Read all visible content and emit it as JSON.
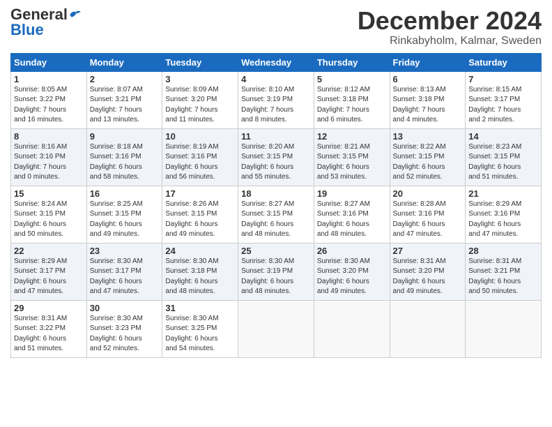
{
  "logo": {
    "general": "General",
    "blue": "Blue"
  },
  "title": "December 2024",
  "location": "Rinkabyholm, Kalmar, Sweden",
  "days_header": [
    "Sunday",
    "Monday",
    "Tuesday",
    "Wednesday",
    "Thursday",
    "Friday",
    "Saturday"
  ],
  "weeks": [
    [
      {
        "day": "1",
        "info": "Sunrise: 8:05 AM\nSunset: 3:22 PM\nDaylight: 7 hours\nand 16 minutes."
      },
      {
        "day": "2",
        "info": "Sunrise: 8:07 AM\nSunset: 3:21 PM\nDaylight: 7 hours\nand 13 minutes."
      },
      {
        "day": "3",
        "info": "Sunrise: 8:09 AM\nSunset: 3:20 PM\nDaylight: 7 hours\nand 11 minutes."
      },
      {
        "day": "4",
        "info": "Sunrise: 8:10 AM\nSunset: 3:19 PM\nDaylight: 7 hours\nand 8 minutes."
      },
      {
        "day": "5",
        "info": "Sunrise: 8:12 AM\nSunset: 3:18 PM\nDaylight: 7 hours\nand 6 minutes."
      },
      {
        "day": "6",
        "info": "Sunrise: 8:13 AM\nSunset: 3:18 PM\nDaylight: 7 hours\nand 4 minutes."
      },
      {
        "day": "7",
        "info": "Sunrise: 8:15 AM\nSunset: 3:17 PM\nDaylight: 7 hours\nand 2 minutes."
      }
    ],
    [
      {
        "day": "8",
        "info": "Sunrise: 8:16 AM\nSunset: 3:16 PM\nDaylight: 7 hours\nand 0 minutes."
      },
      {
        "day": "9",
        "info": "Sunrise: 8:18 AM\nSunset: 3:16 PM\nDaylight: 6 hours\nand 58 minutes."
      },
      {
        "day": "10",
        "info": "Sunrise: 8:19 AM\nSunset: 3:16 PM\nDaylight: 6 hours\nand 56 minutes."
      },
      {
        "day": "11",
        "info": "Sunrise: 8:20 AM\nSunset: 3:15 PM\nDaylight: 6 hours\nand 55 minutes."
      },
      {
        "day": "12",
        "info": "Sunrise: 8:21 AM\nSunset: 3:15 PM\nDaylight: 6 hours\nand 53 minutes."
      },
      {
        "day": "13",
        "info": "Sunrise: 8:22 AM\nSunset: 3:15 PM\nDaylight: 6 hours\nand 52 minutes."
      },
      {
        "day": "14",
        "info": "Sunrise: 8:23 AM\nSunset: 3:15 PM\nDaylight: 6 hours\nand 51 minutes."
      }
    ],
    [
      {
        "day": "15",
        "info": "Sunrise: 8:24 AM\nSunset: 3:15 PM\nDaylight: 6 hours\nand 50 minutes."
      },
      {
        "day": "16",
        "info": "Sunrise: 8:25 AM\nSunset: 3:15 PM\nDaylight: 6 hours\nand 49 minutes."
      },
      {
        "day": "17",
        "info": "Sunrise: 8:26 AM\nSunset: 3:15 PM\nDaylight: 6 hours\nand 49 minutes."
      },
      {
        "day": "18",
        "info": "Sunrise: 8:27 AM\nSunset: 3:15 PM\nDaylight: 6 hours\nand 48 minutes."
      },
      {
        "day": "19",
        "info": "Sunrise: 8:27 AM\nSunset: 3:16 PM\nDaylight: 6 hours\nand 48 minutes."
      },
      {
        "day": "20",
        "info": "Sunrise: 8:28 AM\nSunset: 3:16 PM\nDaylight: 6 hours\nand 47 minutes."
      },
      {
        "day": "21",
        "info": "Sunrise: 8:29 AM\nSunset: 3:16 PM\nDaylight: 6 hours\nand 47 minutes."
      }
    ],
    [
      {
        "day": "22",
        "info": "Sunrise: 8:29 AM\nSunset: 3:17 PM\nDaylight: 6 hours\nand 47 minutes."
      },
      {
        "day": "23",
        "info": "Sunrise: 8:30 AM\nSunset: 3:17 PM\nDaylight: 6 hours\nand 47 minutes."
      },
      {
        "day": "24",
        "info": "Sunrise: 8:30 AM\nSunset: 3:18 PM\nDaylight: 6 hours\nand 48 minutes."
      },
      {
        "day": "25",
        "info": "Sunrise: 8:30 AM\nSunset: 3:19 PM\nDaylight: 6 hours\nand 48 minutes."
      },
      {
        "day": "26",
        "info": "Sunrise: 8:30 AM\nSunset: 3:20 PM\nDaylight: 6 hours\nand 49 minutes."
      },
      {
        "day": "27",
        "info": "Sunrise: 8:31 AM\nSunset: 3:20 PM\nDaylight: 6 hours\nand 49 minutes."
      },
      {
        "day": "28",
        "info": "Sunrise: 8:31 AM\nSunset: 3:21 PM\nDaylight: 6 hours\nand 50 minutes."
      }
    ],
    [
      {
        "day": "29",
        "info": "Sunrise: 8:31 AM\nSunset: 3:22 PM\nDaylight: 6 hours\nand 51 minutes."
      },
      {
        "day": "30",
        "info": "Sunrise: 8:30 AM\nSunset: 3:23 PM\nDaylight: 6 hours\nand 52 minutes."
      },
      {
        "day": "31",
        "info": "Sunrise: 8:30 AM\nSunset: 3:25 PM\nDaylight: 6 hours\nand 54 minutes."
      },
      {
        "day": "",
        "info": ""
      },
      {
        "day": "",
        "info": ""
      },
      {
        "day": "",
        "info": ""
      },
      {
        "day": "",
        "info": ""
      }
    ]
  ]
}
